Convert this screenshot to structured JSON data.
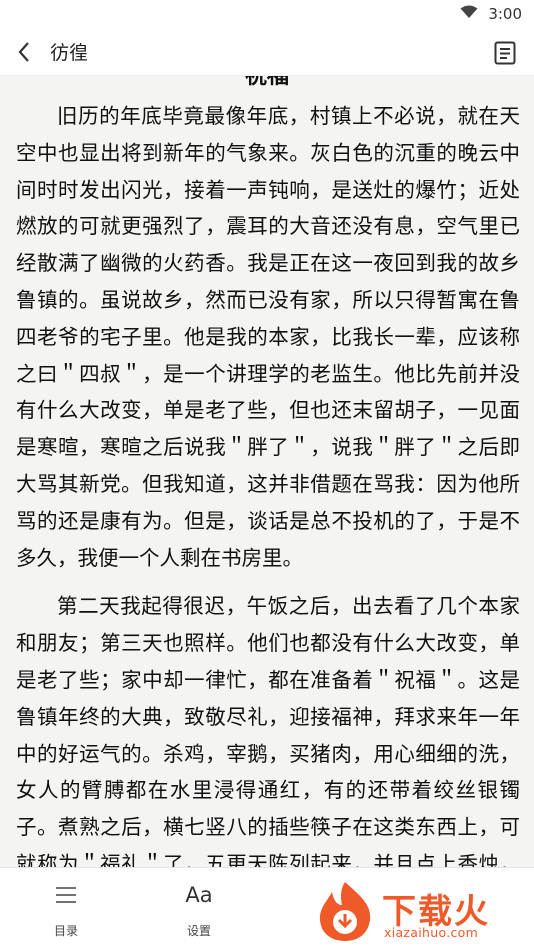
{
  "status_bar": {
    "time": "3:00"
  },
  "header": {
    "title": "彷徨"
  },
  "chapter": {
    "title": "祝福"
  },
  "paragraphs": [
    "旧历的年底毕竟最像年底，村镇上不必说，就在天空中也显出将到新年的气象来。灰白色的沉重的晚云中间时时发出闪光，接着一声钝响，是送灶的爆竹；近处燃放的可就更强烈了，震耳的大音还没有息，空气里已经散满了幽微的火药香。我是正在这一夜回到我的故乡鲁镇的。虽说故乡，然而已没有家，所以只得暂寓在鲁四老爷的宅子里。他是我的本家，比我长一辈，应该称之曰＂四叔＂，是一个讲理学的老监生。他比先前并没有什么大改变，单是老了些，但也还末留胡子，一见面是寒暄，寒暄之后说我＂胖了＂，说我＂胖了＂之后即大骂其新党。但我知道，这并非借题在骂我：因为他所骂的还是康有为。但是，谈话是总不投机的了，于是不多久，我便一个人剩在书房里。",
    "第二天我起得很迟，午饭之后，出去看了几个本家和朋友；第三天也照样。他们也都没有什么大改变，单是老了些；家中却一律忙，都在准备着＂祝福＂。这是鲁镇年终的大典，致敬尽礼，迎接福神，拜求来年一年中的好运气的。杀鸡，宰鹅，买猪肉，用心细细的洗，女人的臂膊都在水里浸得通红，有的还带着绞丝银镯子。煮熟之后，横七竖八的插些筷子在这类东西上，可就称为＂福礼＂了，五更天陈列起来，并且点上香烛，恭请福神们来享用，拜的却只限于男人，拜完自然仍然是放爆竹。年年如此，家家如此"
  ],
  "bottom_bar": {
    "toc_label": "目录",
    "settings_label": "设置",
    "settings_glyph": "Aa"
  },
  "watermark": {
    "text": "下载火",
    "url_text": "xiazaihuo.com"
  },
  "colors": {
    "accent": "#f05a28",
    "reader_bg": "#f4f4f2"
  }
}
